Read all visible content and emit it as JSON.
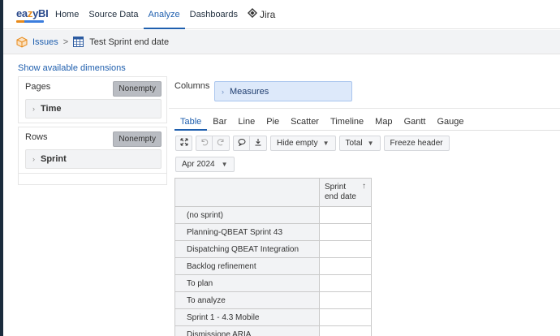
{
  "nav": {
    "logo_prefix": "ea",
    "logo_accent": "z",
    "logo_suffix": "yBI",
    "items": [
      {
        "label": "Home",
        "active": false
      },
      {
        "label": "Source Data",
        "active": false
      },
      {
        "label": "Analyze",
        "active": true
      },
      {
        "label": "Dashboards",
        "active": false
      }
    ],
    "jira_label": "Jira"
  },
  "breadcrumb": {
    "root": "Issues",
    "separator": ">",
    "report": "Test Sprint end date"
  },
  "show_dimensions": "Show available dimensions",
  "pages": {
    "label": "Pages",
    "nonempty": "Nonempty",
    "dimension": "Time"
  },
  "rows": {
    "label": "Rows",
    "nonempty": "Nonempty",
    "dimension": "Sprint"
  },
  "columns": {
    "label": "Columns",
    "dimension": "Measures"
  },
  "tabs": [
    "Table",
    "Bar",
    "Line",
    "Pie",
    "Scatter",
    "Timeline",
    "Map",
    "Gantt",
    "Gauge"
  ],
  "toolbar": {
    "hide_empty": "Hide empty",
    "total": "Total",
    "freeze_header": "Freeze header"
  },
  "page_selector": "Apr 2024",
  "table": {
    "column_header_line1": "Sprint",
    "column_header_line2": "end date",
    "rows": [
      "(no sprint)",
      "Planning-QBEAT Sprint 43",
      "Dispatching QBEAT Integration",
      "Backlog refinement",
      "To plan",
      "To analyze",
      "Sprint 1 - 4.3 Mobile",
      "Dismissione ARIA"
    ]
  },
  "colors": {
    "brand_blue": "#1f5fae",
    "accent_orange": "#e88a1a",
    "measures_bg": "#dde9fa"
  }
}
